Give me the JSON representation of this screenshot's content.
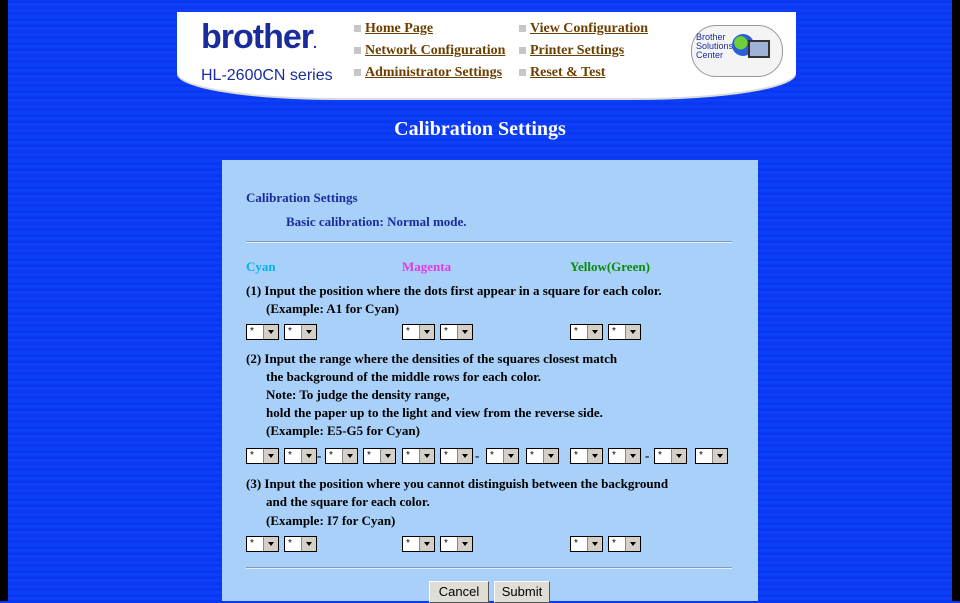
{
  "header": {
    "logo": "brother",
    "series": "HL-2600CN series",
    "nav_left": [
      "Home Page",
      "Network Configuration",
      "Administrator Settings"
    ],
    "nav_right": [
      "View Configuration",
      "Printer Settings",
      "Reset & Test"
    ],
    "solutions_center": "Brother Solutions Center"
  },
  "page": {
    "title": "Calibration Settings"
  },
  "panel": {
    "heading": "Calibration Settings",
    "subheading": "Basic calibration: Normal mode.",
    "colors": {
      "cyan": "Cyan",
      "magenta": "Magenta",
      "yellow": "Yellow(Green)"
    },
    "step1": {
      "line1": "(1) Input the position where the dots first appear in a square for each color.",
      "line2": "(Example: A1 for Cyan)"
    },
    "step2": {
      "line1": "(2) Input the range where the densities of the squares closest match",
      "line2": "the background of the middle rows for each color.",
      "line3": "Note: To judge the density range,",
      "line4": "hold the paper up to the light and view from the reverse side.",
      "line5": "(Example: E5-G5 for Cyan)"
    },
    "step3": {
      "line1": "(3) Input the position where you cannot distinguish between the background",
      "line2": "and the square for each color.",
      "line3": "(Example: I7 for Cyan)"
    },
    "select_value": "*",
    "dash": "-",
    "buttons": {
      "cancel": "Cancel",
      "submit": "Submit"
    }
  },
  "colors": {
    "background": "#0d3ff8",
    "panel": "#a8d0f8",
    "heading_text": "#1a2c9c",
    "nav_link": "#6b3f00",
    "cyan": "#00b4e8",
    "magenta": "#e23be6",
    "yellow": "#0a8d0a"
  }
}
